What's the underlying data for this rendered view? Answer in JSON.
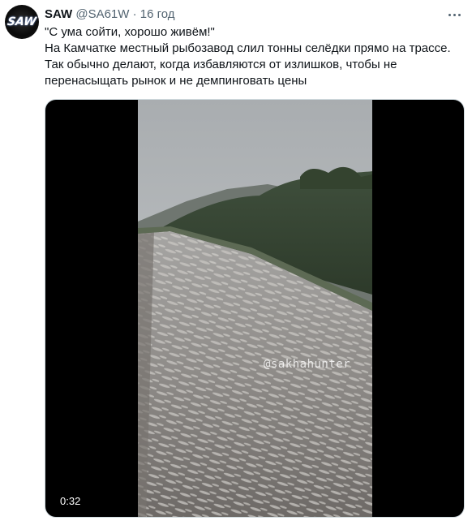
{
  "tweet": {
    "author_name": "SAW",
    "author_handle": "@SA61W",
    "separator": "·",
    "time": "16 год",
    "avatar_text": "SAW",
    "more_icon": "more-horizontal-icon",
    "text_lines": [
      "\"С ума сойти, хорошо живём!\"",
      "На Камчатке местный рыбозавод слил тонны селёдки прямо на трассе.",
      "Так обычно делают, когда избавляются от излишков, чтобы не перенасыщать рынок и не демпинговать цены"
    ]
  },
  "video": {
    "watermark": "@sakhahunter",
    "duration": "0:32"
  }
}
